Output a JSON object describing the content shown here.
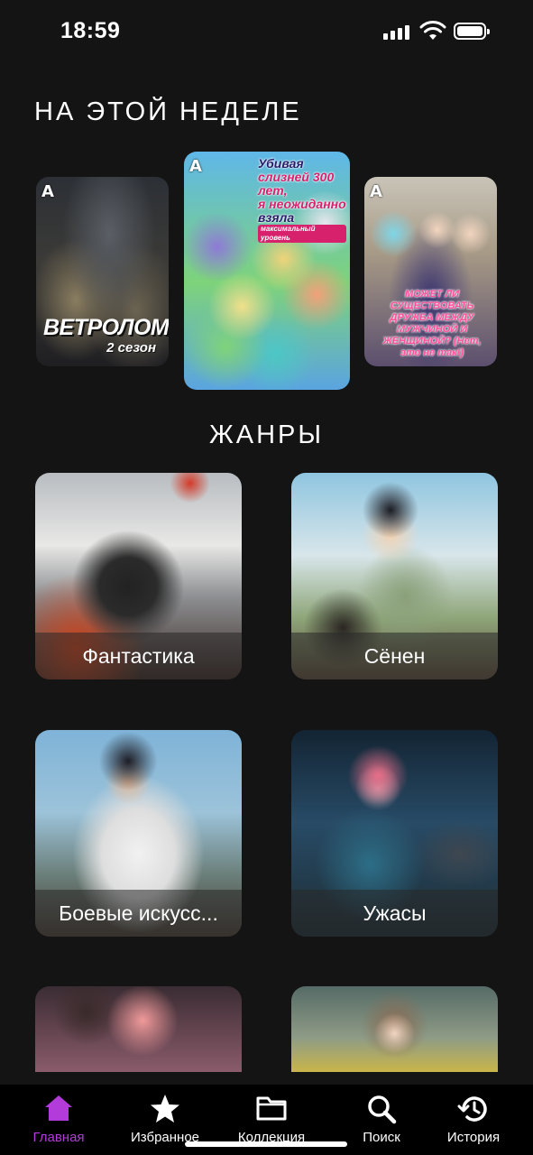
{
  "status_bar": {
    "time": "18:59"
  },
  "this_week": {
    "title": "НА ЭТОЙ НЕДЕЛЕ",
    "posters": [
      {
        "logo": "A",
        "title": "ВЕТРОЛОМ",
        "subtitle": "2 сезон"
      },
      {
        "logo": "A",
        "title_line1": "Убивая",
        "title_line2": "слизней 300 лет,",
        "title_line3": "я неожиданно",
        "title_line4": "взяла",
        "title_line5": "максимальный уровень"
      },
      {
        "logo": "A",
        "title": "МОЖЕТ ЛИ СУЩЕСТВОВАТЬ ДРУЖБА МЕЖДУ МУЖЧИНОЙ И ЖЕНЩИНОЙ? (Нет, это не так!)"
      }
    ]
  },
  "genres": {
    "title": "ЖАНРЫ",
    "items": [
      {
        "label": "Фантастика"
      },
      {
        "label": "Сёнен"
      },
      {
        "label": "Боевые искусс..."
      },
      {
        "label": "Ужасы"
      }
    ]
  },
  "nav": {
    "accent_color": "#b23bd9",
    "items": [
      {
        "label": "Главная",
        "icon": "home-icon",
        "active": true
      },
      {
        "label": "Избранное",
        "icon": "star-icon"
      },
      {
        "label": "Коллекция",
        "icon": "folder-icon"
      },
      {
        "label": "Поиск",
        "icon": "search-icon"
      },
      {
        "label": "История",
        "icon": "history-icon"
      }
    ]
  }
}
